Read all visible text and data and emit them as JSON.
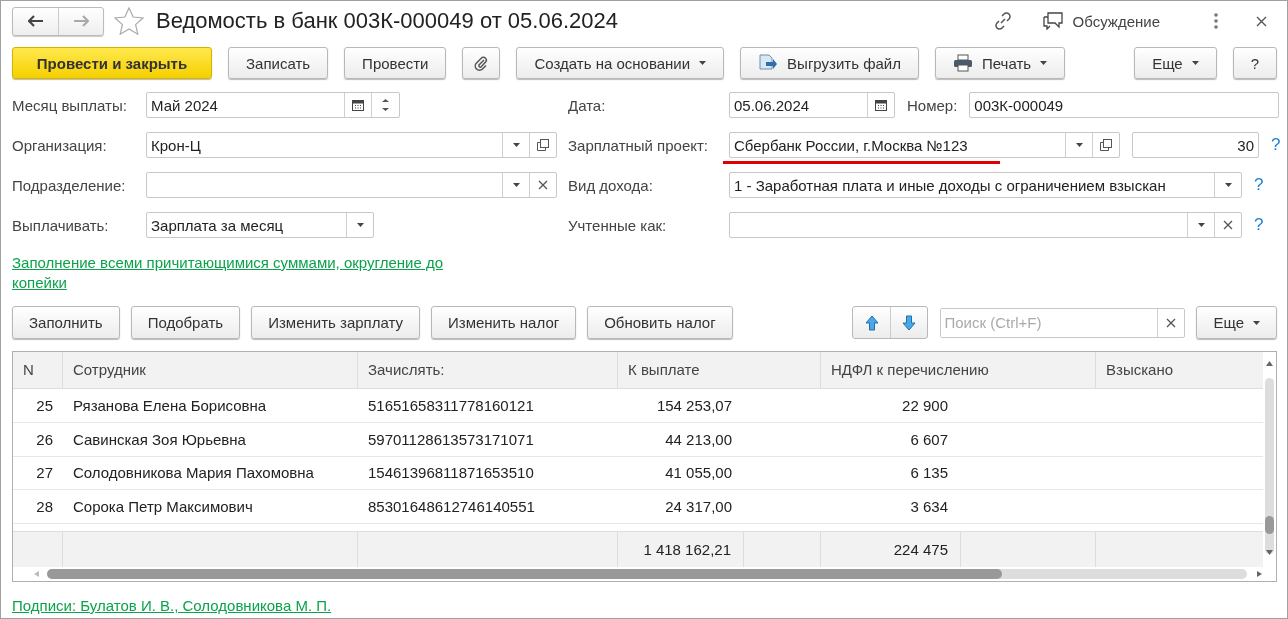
{
  "window": {
    "title": "Ведомость в банк 003К-000049 от 05.06.2024",
    "discussion": "Обсуждение"
  },
  "toolbar": [
    {
      "kind": "primary",
      "label": "Провести и закрыть"
    },
    {
      "kind": "plain",
      "label": "Записать"
    },
    {
      "kind": "plain",
      "label": "Провести"
    },
    {
      "kind": "attach"
    },
    {
      "kind": "dropdown",
      "label": "Создать на основании"
    },
    {
      "kind": "export",
      "label": "Выгрузить файл"
    },
    {
      "kind": "print",
      "label": "Печать"
    },
    {
      "kind": "more",
      "label": "Еще"
    },
    {
      "kind": "plain",
      "label": "?"
    }
  ],
  "form": {
    "payment_month": {
      "label": "Месяц выплаты:",
      "value": "Май 2024"
    },
    "date": {
      "label": "Дата:",
      "value": "05.06.2024"
    },
    "number": {
      "label": "Номер:",
      "value": "003К-000049"
    },
    "organization": {
      "label": "Организация:",
      "value": "Крон-Ц"
    },
    "salary_project": {
      "label": "Зарплатный проект:",
      "value": "Сбербанк России, г.Москва №123",
      "highlighted": true,
      "count": "30",
      "help": "?"
    },
    "department": {
      "label": "Подразделение:"
    },
    "income_type": {
      "label": "Вид дохода:",
      "value": "1 - Заработная плата и иные доходы с ограничением взыскан",
      "help": "?"
    },
    "pay": {
      "label": "Выплачивать:",
      "value": "Зарплата за месяц"
    },
    "counted_as": {
      "label": "Учтенные как:",
      "help": "?"
    }
  },
  "fill_link": "Заполнение всеми причитающимися суммами, округление до копейки",
  "table_toolbar": {
    "buttons": [
      "Заполнить",
      "Подобрать",
      "Изменить зарплату",
      "Изменить налог",
      "Обновить налог"
    ],
    "search": {
      "placeholder": "Поиск (Ctrl+F)"
    },
    "more": "Еще"
  },
  "table": {
    "columns": [
      "N",
      "Сотрудник",
      "Зачислять:",
      "К выплате",
      "НДФЛ к перечислению",
      "Взыскано"
    ],
    "rows": [
      {
        "n": "25",
        "employee": "Рязанова Елена Борисовна",
        "account": "51651658311778160121",
        "payout": "154 253,07",
        "ndfl": "22 900"
      },
      {
        "n": "26",
        "employee": "Савинская Зоя Юрьевна",
        "account": "59701128613573171071",
        "payout": "44 213,00",
        "ndfl": "6 607"
      },
      {
        "n": "27",
        "employee": "Солодовникова Мария Пахомовна",
        "account": "15461396811871653510",
        "payout": "41 055,00",
        "ndfl": "6 135"
      },
      {
        "n": "28",
        "employee": "Сорока Петр Максимович",
        "account": "85301648612746140551",
        "payout": "24 317,00",
        "ndfl": "3 634"
      }
    ],
    "totals": {
      "payout": "1 418 162,21",
      "ndfl": "224 475"
    }
  },
  "signatures_link": "Подписи: Булатов И. В., Солодовникова М. П."
}
